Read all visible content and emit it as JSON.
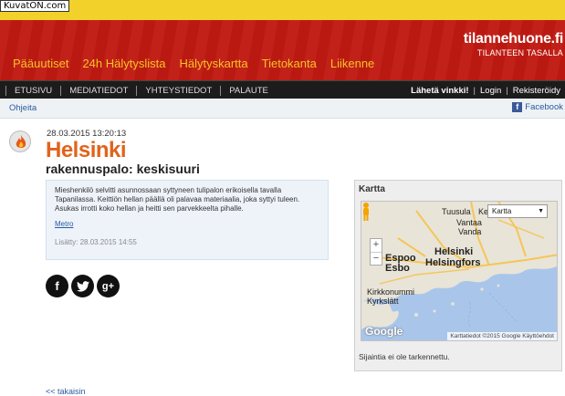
{
  "watermark": "KuvatON.com",
  "site": {
    "title": "tilannehuone.fi",
    "tagline": "TILANTEEN TASALLA"
  },
  "main_nav": [
    "Pääuutiset",
    "24h Hälytyslista",
    "Hälytyskartta",
    "Tietokanta",
    "Liikenne"
  ],
  "sub_nav": [
    "ETUSIVU",
    "MEDIATIEDOT",
    "YHTEYSTIEDOT",
    "PALAUTE"
  ],
  "user_nav": {
    "tip": "Lähetä vinkki!",
    "login": "Login",
    "register": "Rekisteröidy"
  },
  "util": {
    "help": "Ohjeita",
    "facebook": "Facebook"
  },
  "article": {
    "timestamp": "28.03.2015 13:20:13",
    "city": "Helsinki",
    "event": "rakennuspalo: keskisuuri",
    "description": "Mieshenkilö selvitti asunnossaan syttyneen tulipalon erikoisella tavalla Tapanilassa. Keittiön hellan päällä oli palavaa materiaalia, joka syttyi tuleen. Asukas irrotti koko hellan ja heitti sen parvekkeelta pihalle.",
    "source": "Metro",
    "added": "Lisätty: 28.03.2015 14:55"
  },
  "share": {
    "facebook": "f",
    "twitter": "t",
    "google": "g+"
  },
  "map": {
    "title": "Kartta",
    "type_select": "Kartta",
    "labels": {
      "tuusula": "Tuusula",
      "kerava": "Ker",
      "vantaa": "Vantaa",
      "vanda": "Vanda",
      "espoo": "Espoo",
      "esbo": "Esbo",
      "helsinki": "Helsinki",
      "helsingfors": "Helsingfors",
      "kirkkonummi": "Kirkkonummi",
      "kyrkslatt": "Kyrkslätt"
    },
    "zoom_in": "+",
    "zoom_out": "−",
    "google": "Google",
    "attribution": "Karttatiedot ©2015 Google   Käyttöehdot",
    "note": "Sijaintia ei ole tarkennettu."
  },
  "back": "<< takaisin",
  "colors": {
    "header_red": "#c01a12",
    "nav_yellow": "#f6c324",
    "city_orange": "#e0641c"
  }
}
